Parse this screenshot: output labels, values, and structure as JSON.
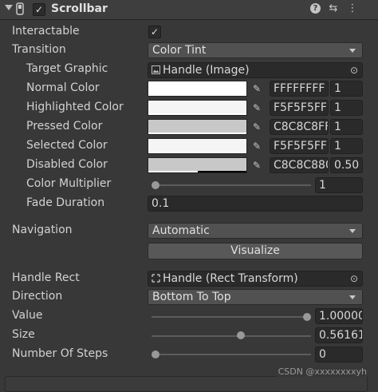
{
  "header": {
    "title": "Scrollbar",
    "enabled": true,
    "help_label": "?",
    "preset_glyph": "⇆",
    "menu_glyph": "⋮"
  },
  "fields": {
    "interactable": {
      "label": "Interactable",
      "checked": true,
      "check_glyph": "✓"
    },
    "transition": {
      "label": "Transition",
      "value": "Color Tint"
    },
    "target_graphic": {
      "label": "Target Graphic",
      "value": "Handle (Image)"
    },
    "normal_color": {
      "label": "Normal Color",
      "hex": "FFFFFFFF",
      "multiplier": "1",
      "color": "#FFFFFF"
    },
    "highlighted_color": {
      "label": "Highlighted Color",
      "hex": "F5F5F5FF",
      "multiplier": "1",
      "color": "#F5F5F5"
    },
    "pressed_color": {
      "label": "Pressed Color",
      "hex": "C8C8C8FF",
      "multiplier": "1",
      "color": "#C8C8C8"
    },
    "selected_color": {
      "label": "Selected Color",
      "hex": "F5F5F5FF",
      "multiplier": "1",
      "color": "#F5F5F5"
    },
    "disabled_color": {
      "label": "Disabled Color",
      "hex": "C8C8C880",
      "multiplier": "0.50",
      "color": "#C8C8C8",
      "alpha": 0.5
    },
    "color_multiplier": {
      "label": "Color Multiplier",
      "value": "1",
      "slider": 0.0
    },
    "fade_duration": {
      "label": "Fade Duration",
      "value": "0.1"
    },
    "navigation": {
      "label": "Navigation",
      "value": "Automatic"
    },
    "visualize": {
      "label": "Visualize"
    },
    "handle_rect": {
      "label": "Handle Rect",
      "value": "Handle (Rect Transform)"
    },
    "direction": {
      "label": "Direction",
      "value": "Bottom To Top"
    },
    "value": {
      "label": "Value",
      "value": "1.00000",
      "slider": 1.0
    },
    "size": {
      "label": "Size",
      "value": "0.56161",
      "slider": 0.56161
    },
    "number_of_steps": {
      "label": "Number Of Steps",
      "value": "0",
      "slider": 0.0
    }
  },
  "icons": {
    "picker_glyph": "✎",
    "target_glyph": "⊙",
    "rect_glyph": "⁙"
  },
  "watermark": "CSDN @xxxxxxxxyh",
  "colors": {
    "panel": "#383838",
    "header": "#3e3e3e",
    "field": "#2a2a2a",
    "dropdown": "#515151",
    "button": "#585858",
    "text": "#d2d2d2"
  }
}
